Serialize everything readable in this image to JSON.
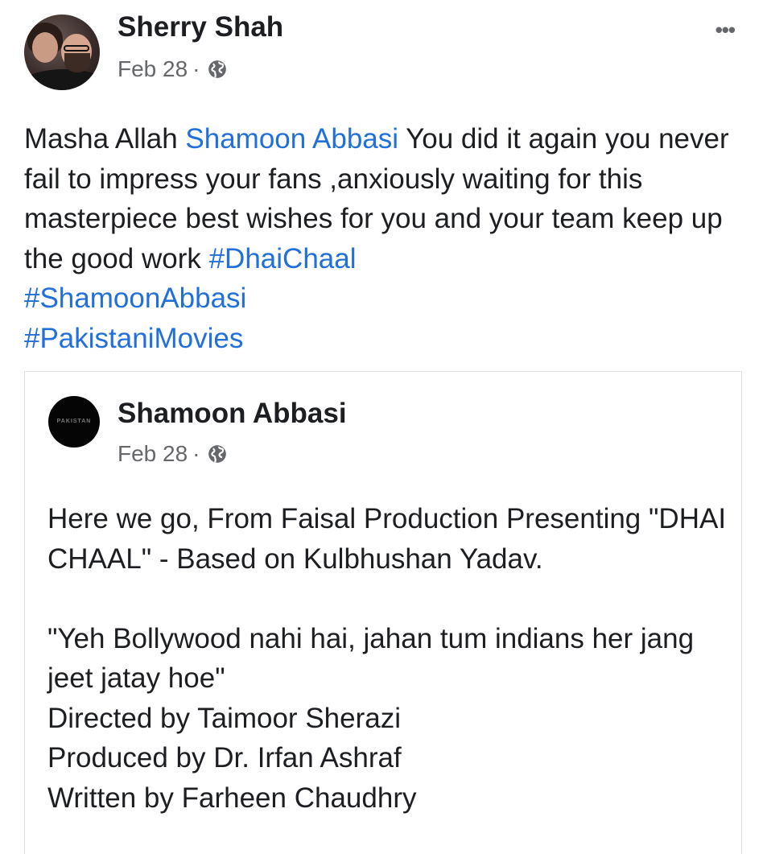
{
  "post": {
    "author": "Sherry Shah",
    "date": "Feb 28",
    "separator": "·",
    "privacy_icon": "globe-icon",
    "more_icon": "•••",
    "text_prefix": "Masha Allah ",
    "mention": "Shamoon Abbasi",
    "text_body": " You did it again you never fail to impress your fans ,anxiously waiting for this masterpiece best wishes for you and your team keep up the good work ",
    "hashtags": [
      "#DhaiChaal",
      "#ShamoonAbbasi",
      "#PakistaniMovies"
    ]
  },
  "shared_post": {
    "author": "Shamoon Abbasi",
    "avatar_text": "PAKISTAN",
    "date": "Feb 28",
    "separator": "·",
    "privacy_icon": "globe-icon",
    "paragraph1": "Here we go, From Faisal Production Presenting \"DHAI CHAAL\" - Based on Kulbhushan Yadav.",
    "quote": "\"Yeh Bollywood nahi hai, jahan tum indians her jang jeet jatay hoe\"",
    "directed": "Directed by Taimoor Sherazi",
    "produced": "Produced by Dr. Irfan Ashraf",
    "written": "Written by Farheen Chaudhry"
  },
  "colors": {
    "link": "#216fdb",
    "text": "#1c1e21",
    "meta": "#65676b",
    "border": "#dddfe2"
  }
}
